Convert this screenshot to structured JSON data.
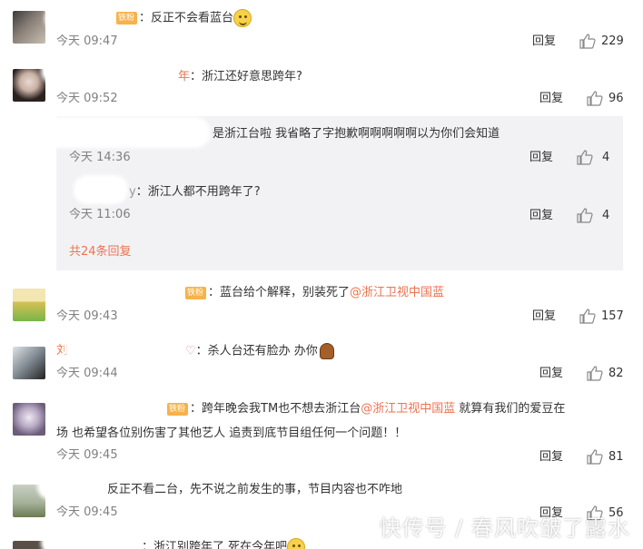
{
  "comments": [
    {
      "text": "反正不会看蓝台",
      "time": "今天 09:47",
      "reply": "回复",
      "likes": "229"
    },
    {
      "text": "浙江还好意思跨年?",
      "time": "今天 09:52",
      "reply": "回复",
      "likes": "96"
    },
    {
      "text_a": "蓝台给个解释，别装死了",
      "mention": "@浙江卫视中国蓝",
      "time": "今天 09:43",
      "reply": "回复",
      "likes": "157"
    },
    {
      "text": "杀人台还有脸办 办你",
      "time": "今天 09:44",
      "reply": "回复",
      "likes": "82"
    },
    {
      "text_a": "跨年晚会我TM也不想去浙江台",
      "mention": "@浙江卫视中国蓝",
      "text_b": " 就算有我们的爱豆在",
      "text_line2": "场 也希望各位别伤害了其他艺人 追责到底节目组任何一个问题！！",
      "time": "今天 09:45",
      "reply": "回复",
      "likes": "81"
    },
    {
      "text": "反正不看二台，先不说之前发生的事，节目内容也不咋地",
      "time": "今天 09:45",
      "reply": "回复",
      "likes": "56"
    },
    {
      "text": "浙江别跨年了 死在今年吧"
    }
  ],
  "sub_replies": [
    {
      "text": "是浙江台啦  我省略了字抱歉啊啊啊啊啊以为你们会知道",
      "time": "今天 14:36",
      "reply": "回复",
      "likes": "4"
    },
    {
      "prefix": "y",
      "text": "浙江人都不用跨年了?",
      "time": "今天 11:06",
      "reply": "回复",
      "likes": "4"
    }
  ],
  "more_replies": "共24条回复",
  "badge_label": "铁粉",
  "name_fragments": {
    "c2": "年",
    "c4_first": "刘",
    "c4_end": "♡"
  },
  "watermark": "快传号 / 春风吹皱了露水"
}
